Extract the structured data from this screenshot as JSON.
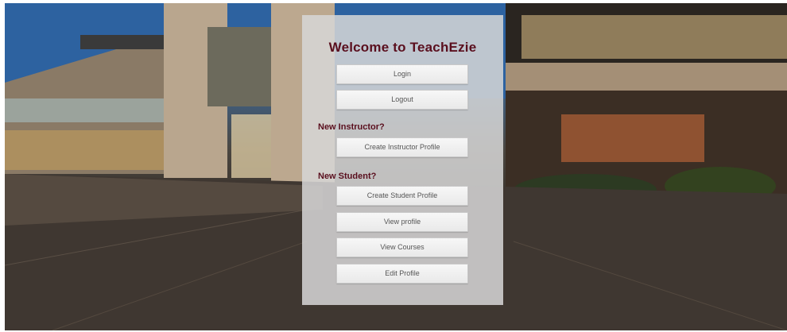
{
  "page": {
    "title": "Welcome to TeachEzie",
    "buttons": {
      "login": "Login",
      "logout": "Logout",
      "create_instructor": "Create Instructor Profile",
      "create_student": "Create Student Profile",
      "view_profile": "View profile",
      "view_courses": "View Courses",
      "edit_profile": "Edit Profile"
    },
    "sections": {
      "new_instructor": "New Instructor?",
      "new_student": "New Student?"
    }
  },
  "colors": {
    "title": "#5a0f1e",
    "panel": "#d6d6d6",
    "button": "#f0f0f0",
    "button_text": "#555555"
  }
}
